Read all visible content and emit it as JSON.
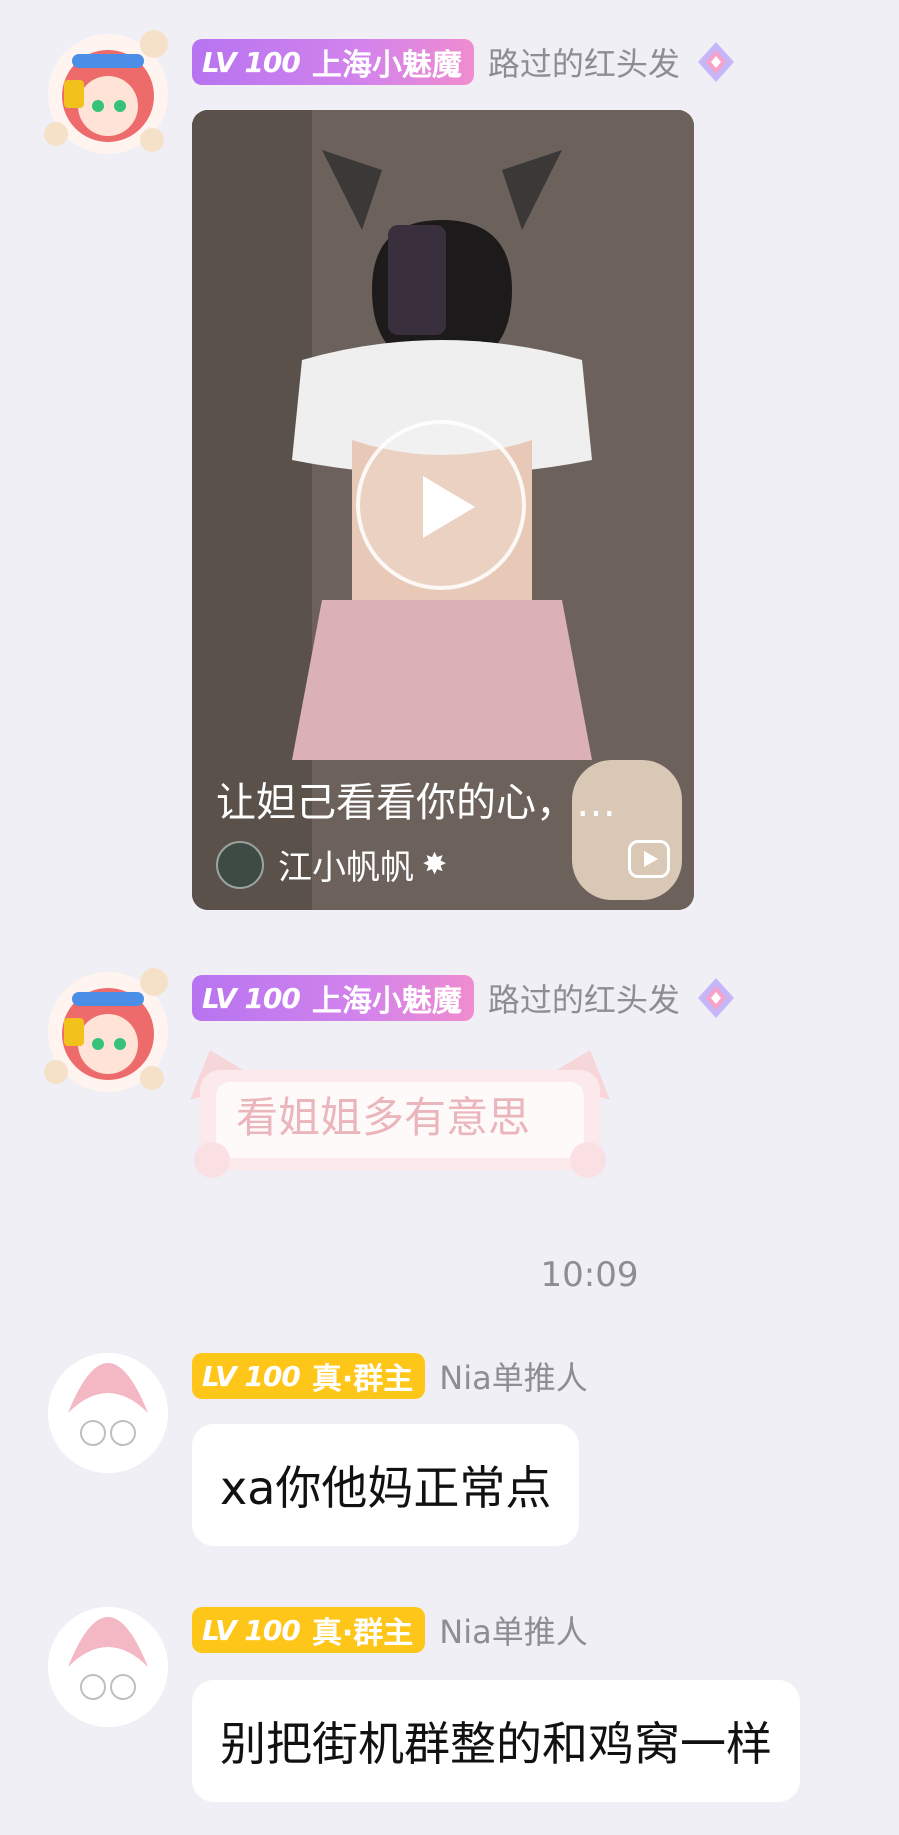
{
  "messages": [
    {
      "level": "LV 100",
      "group_title": "上海小魅魔",
      "username": "路过的红头发",
      "video": {
        "caption": "让妲己看看你的心，…",
        "author": "江小帆帆"
      }
    },
    {
      "level": "LV 100",
      "group_title": "上海小魅魔",
      "username": "路过的红头发",
      "text": "看姐姐多有意思"
    },
    {
      "level": "LV 100",
      "group_title": "真·群主",
      "username": "Nia单推人",
      "text": "xa你他妈正常点"
    },
    {
      "level": "LV 100",
      "group_title": "真·群主",
      "username": "Nia单推人",
      "text": "别把街机群整的和鸡窝一样"
    }
  ],
  "timestamp": "10:09",
  "colors": {
    "background": "#efeff5",
    "badge_purple": "#c27df0",
    "badge_yellow": "#ffc61a",
    "username_gray": "#8d8d93"
  },
  "icons": [
    "anime-avatar-icon",
    "gem-icon",
    "play-icon",
    "video-icon",
    "cat-ear-bubble"
  ]
}
